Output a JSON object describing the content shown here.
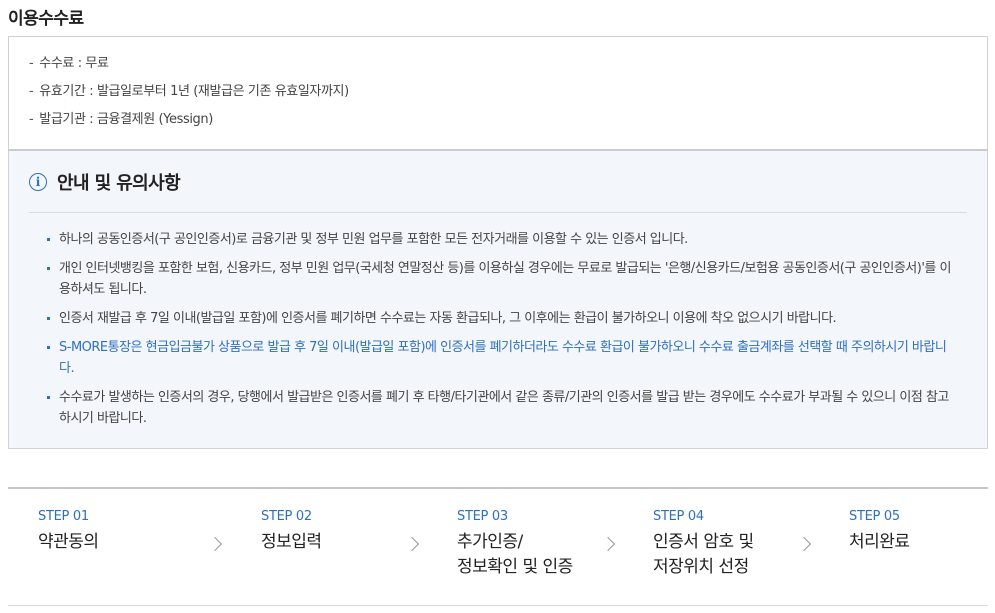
{
  "page": {
    "title": "이용수수료"
  },
  "fees": [
    {
      "dash": "-",
      "text": "수수료 : 무료"
    },
    {
      "dash": "-",
      "text": "유효기간 : 발급일로부터 1년 (재발급은 기존 유효일자까지)"
    },
    {
      "dash": "-",
      "text": "발급기관 : 금융결제원 (Yessign)"
    }
  ],
  "notice": {
    "icon": "i",
    "title": "안내 및 유의사항",
    "items": [
      "하나의 공동인증서(구 공인인증서)로 금융기관 및 정부 민원 업무를 포함한 모든 전자거래를 이용할 수 있는 인증서 입니다.",
      "개인 인터넷뱅킹을 포함한 보험, 신용카드, 정부 민원 업무(국세청 연말정산 등)를 이용하실 경우에는 무료로 발급되는 '은행/신용카드/보험용 공동인증서(구 공인인증서)'를 이용하셔도 됩니다.",
      "인증서 재발급 후 7일 이내(발급일 포함)에 인증서를 폐기하면 수수료는 자동 환급되나, 그 이후에는 환급이 불가하오니 이용에 착오 없으시기 바랍니다.",
      "S-MORE통장은 현금입금불가 상품으로 발급 후 7일 이내(발급일 포함)에 인증서를 폐기하더라도 수수료 환급이 불가하오니 수수료 출금계좌를 선택할 때 주의하시기 바랍니다.",
      "수수료가 발생하는 인증서의 경우, 당행에서 발급받은 인증서를 폐기 후 타행/타기관에서 같은 종류/기관의 인증서를 발급 받는 경우에도 수수료가 부과될 수 있으니 이점 참고하시기 바랍니다."
    ]
  },
  "steps": [
    {
      "no": "STEP 01",
      "name": "약관동의"
    },
    {
      "no": "STEP 02",
      "name": "정보입력"
    },
    {
      "no": "STEP 03",
      "name": "추가인증/\n정보확인 및 인증"
    },
    {
      "no": "STEP 04",
      "name": "인증서 암호 및\n저장위치 선정"
    },
    {
      "no": "STEP 05",
      "name": "처리완료"
    }
  ],
  "colors": {
    "accent": "#2f6fc0",
    "notice_bg": "#f3f6fa"
  }
}
